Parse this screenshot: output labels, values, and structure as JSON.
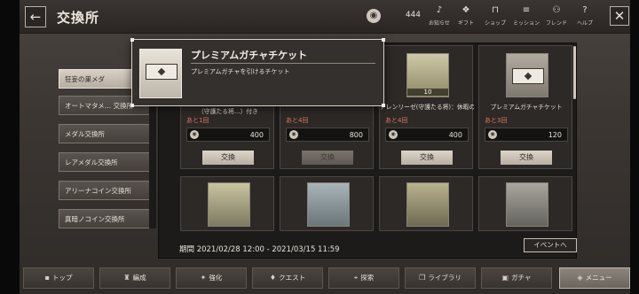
{
  "header": {
    "title": "交換所",
    "back_icon": "left-arrow-icon",
    "currency_value": "444",
    "buttons": [
      {
        "label": "お知らせ",
        "icon": "bell-icon"
      },
      {
        "label": "ギフト",
        "icon": "gift-icon"
      },
      {
        "label": "ショップ",
        "icon": "shop-icon"
      },
      {
        "label": "ミッション",
        "icon": "mission-icon"
      },
      {
        "label": "フレンド",
        "icon": "friend-icon"
      },
      {
        "label": "ヘルプ",
        "icon": "help-icon"
      }
    ]
  },
  "sidebar": {
    "items": [
      {
        "label": "狂妄の巣メダ"
      },
      {
        "label": "オートマタメ… 交換所"
      },
      {
        "label": "メダル交換所"
      },
      {
        "label": "レアメダル交換所"
      },
      {
        "label": "アリーナコイン交換所"
      },
      {
        "label": "真暗ノコイン交換所"
      }
    ]
  },
  "cards": [
    {
      "name": "（守護たる将…）付き",
      "remain": "あと1回",
      "price": "400",
      "button": "交換",
      "disabled": false
    },
    {
      "name": "",
      "remain": "あと4回",
      "price": "800",
      "button": "交換",
      "disabled": true
    },
    {
      "name": "アレンリーゼ(守護たる将)：休暇の書",
      "remain": "あと4回",
      "price": "400",
      "button": "交換",
      "disabled": false,
      "badge": "10"
    },
    {
      "name": "プレミアムガチャチケット",
      "remain": "あと3回",
      "price": "120",
      "button": "交換",
      "disabled": false
    }
  ],
  "period": "期間 2021/02/28 12:00 - 2021/03/15 11:59",
  "event_button": "イベントへ",
  "tooltip": {
    "title": "プレミアムガチャチケット",
    "description": "プレミアムガチャを引けるチケット"
  },
  "bottom_nav": [
    {
      "label": "トップ",
      "icon": "top-icon"
    },
    {
      "label": "編成",
      "icon": "formation-icon"
    },
    {
      "label": "強化",
      "icon": "upgrade-icon"
    },
    {
      "label": "クエスト",
      "icon": "quest-icon"
    },
    {
      "label": "探索",
      "icon": "explore-icon"
    },
    {
      "label": "ライブラリ",
      "icon": "library-icon"
    },
    {
      "label": "ガチャ",
      "icon": "gacha-icon"
    },
    {
      "label": "メニュー",
      "icon": "menu-icon"
    }
  ]
}
